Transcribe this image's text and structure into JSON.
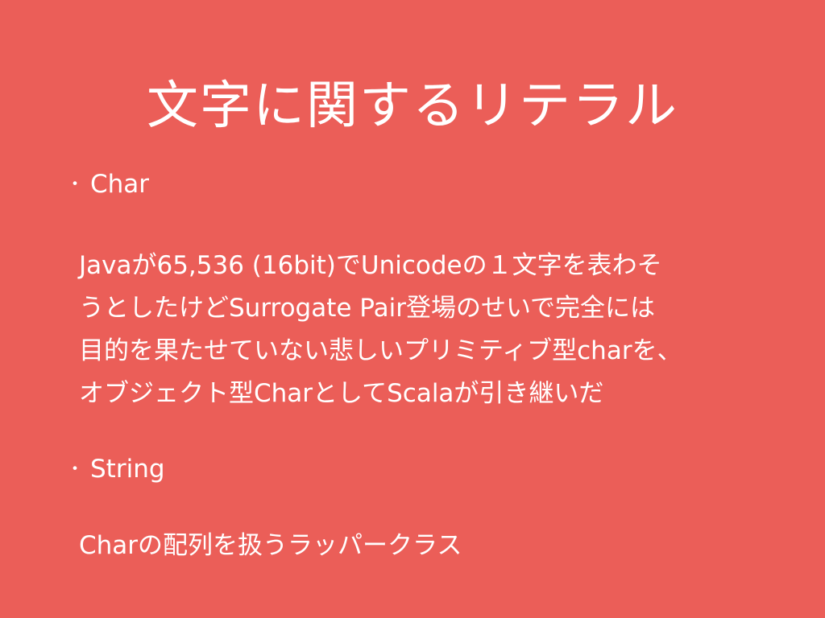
{
  "slide": {
    "title": "文字に関するリテラル",
    "bullets": [
      {
        "marker": "・",
        "label": "Char",
        "description_lines": [
          "Javaが65,536 (16bit)でUnicodeの１文字を表わそ",
          "うとしたけどSurrogate Pair登場のせいで完全には",
          "目的を果たせていない悲しいプリミティブ型charを、",
          "オブジェクト型CharとしてScalaが引き継いだ"
        ]
      },
      {
        "marker": "・",
        "label": "String",
        "description_lines": [
          "Charの配列を扱うラッパークラス"
        ]
      }
    ]
  },
  "colors": {
    "background": "#EB5E58",
    "text": "#FFFFFF"
  }
}
